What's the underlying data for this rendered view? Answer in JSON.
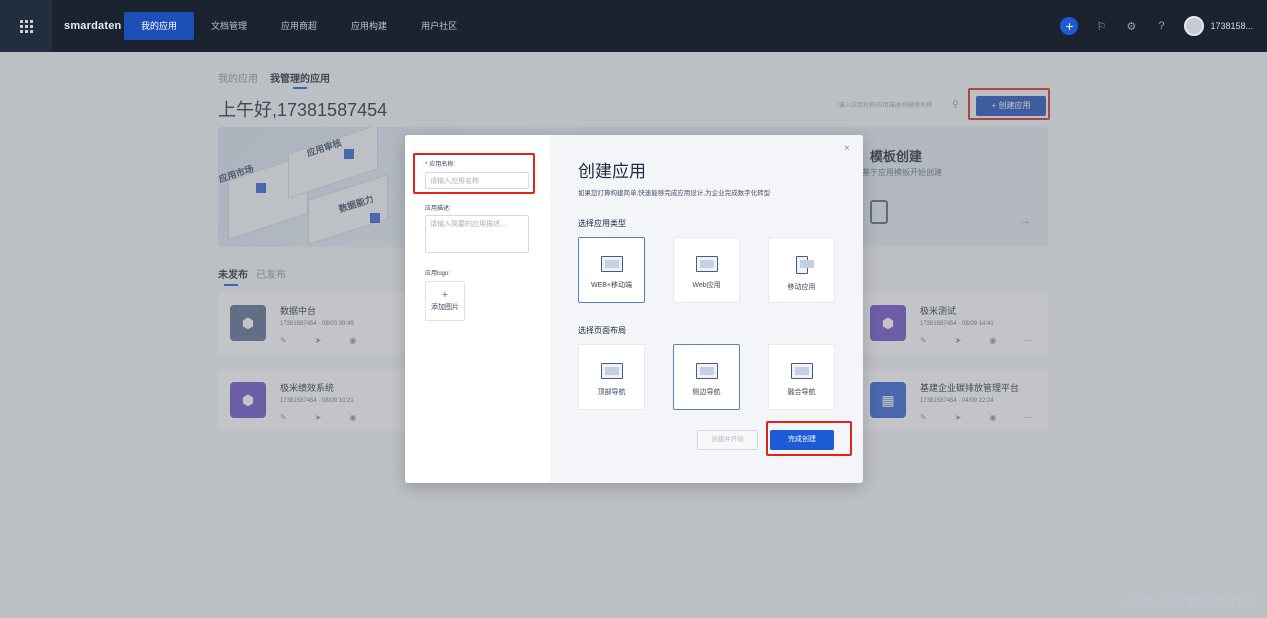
{
  "nav": {
    "brand": "smardaten",
    "items": [
      "我的应用",
      "文档管理",
      "应用商超",
      "应用构建",
      "用户社区"
    ],
    "active": 0,
    "user": "1738158..."
  },
  "page": {
    "tabs": [
      "我的应用",
      "我管理的应用"
    ],
    "greeting": "上午好,17381587454",
    "search_placeholder": "输入应用名称/应用描述/创建者名称",
    "create_button": "创建应用",
    "banner": {
      "labels": [
        "应用市场",
        "应用审核",
        "数据能力"
      ],
      "title": "模板创建",
      "subtitle": "基于应用模板开始创建"
    },
    "sub_tabs": [
      "未发布",
      "已发布"
    ],
    "cards": [
      {
        "name": "数据中台",
        "meta": "17381587454 · 08/03 09:49",
        "color": "#5b6c8f",
        "icon": "hex-icon"
      },
      {
        "name": "极米测试",
        "meta": "17381587454 · 08/09 14:41",
        "color": "#6b4fc7",
        "icon": "hex-icon"
      },
      {
        "name": "极米绩效系统",
        "meta": "17381587454 · 08/09 10:21",
        "color": "#6b4fc7",
        "icon": "hex-icon"
      },
      {
        "name": "基建企业碳排放管理平台",
        "meta": "17381587454 · 04/09 22:24",
        "color": "#2f5fd0",
        "icon": "grid-icon"
      }
    ]
  },
  "modal": {
    "name_label": "应用名称:",
    "name_placeholder": "请输入应用名称",
    "desc_label": "应用描述:",
    "desc_placeholder": "请输入简要的应用描述...",
    "logo_label": "应用logo:",
    "logo_button": "添加图片",
    "title": "创建应用",
    "description": "如果您打算构建简单,快速能够完成应用设计,为企业完成数字化转型",
    "type_label": "选择应用类型",
    "types": [
      "WEB+移动端",
      "Web应用",
      "移动应用"
    ],
    "layout_label": "选择页面布局",
    "layouts": [
      "顶部导航",
      "侧边导航",
      "融合导航"
    ],
    "secondary_button": "创建并开始",
    "primary_button": "完成创建",
    "close": "×"
  },
  "watermark": "@稀土掘金技术社区"
}
